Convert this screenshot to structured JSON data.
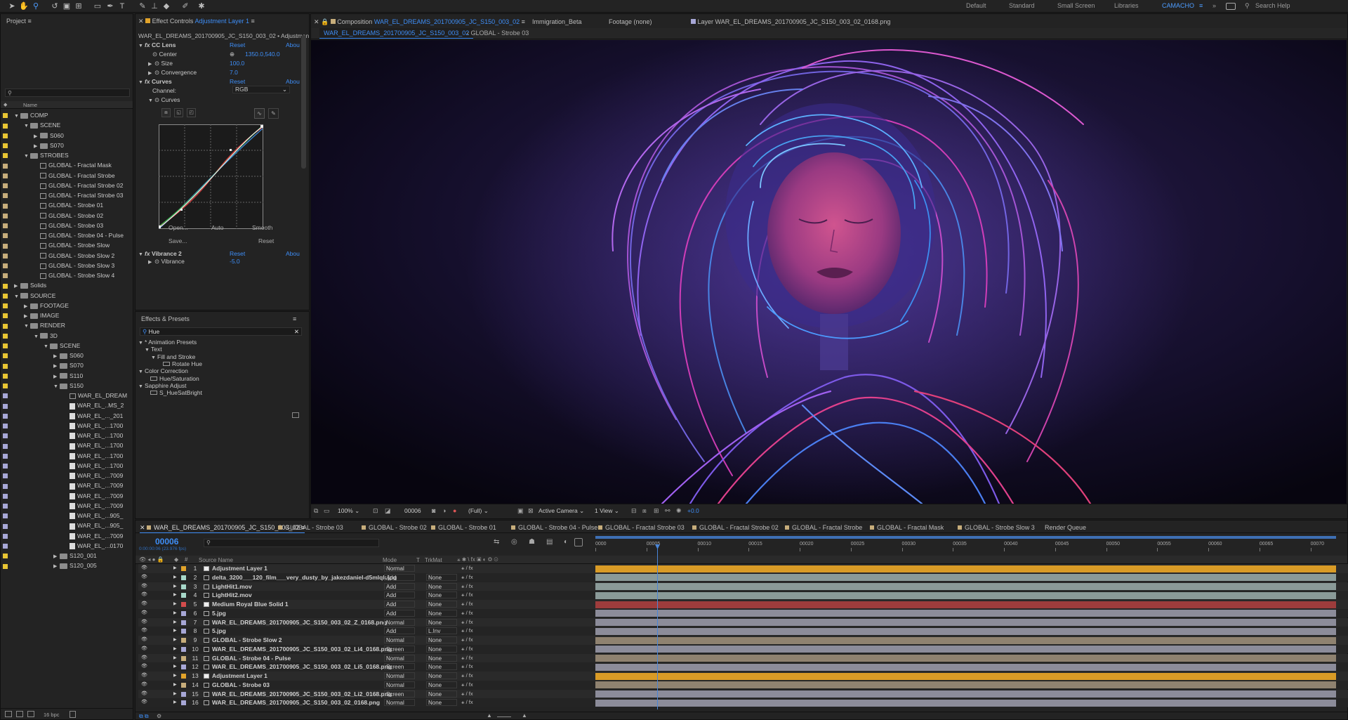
{
  "workspaces": {
    "items": [
      "Default",
      "Standard",
      "Small Screen",
      "Libraries",
      "CAMACHO"
    ],
    "search_placeholder": "Search Help"
  },
  "project": {
    "title": "Project",
    "col_name": "Name",
    "tree": [
      {
        "label": "COMP",
        "level": 0,
        "type": "folder",
        "open": true,
        "color": "#e8c533"
      },
      {
        "label": "SCENE",
        "level": 1,
        "type": "folder",
        "open": true,
        "color": "#e8c533"
      },
      {
        "label": "S060",
        "level": 2,
        "type": "folder",
        "open": false,
        "color": "#e8c533"
      },
      {
        "label": "S070",
        "level": 2,
        "type": "folder",
        "open": false,
        "color": "#e8c533"
      },
      {
        "label": "STROBES",
        "level": 1,
        "type": "folder",
        "open": true,
        "color": "#e8c533"
      },
      {
        "label": "GLOBAL - Fractal Mask",
        "level": 2,
        "type": "comp",
        "color": "#c7ad7b"
      },
      {
        "label": "GLOBAL - Fractal Strobe",
        "level": 2,
        "type": "comp",
        "color": "#c7ad7b"
      },
      {
        "label": "GLOBAL - Fractal Strobe 02",
        "level": 2,
        "type": "comp",
        "color": "#c7ad7b"
      },
      {
        "label": "GLOBAL - Fractal Strobe 03",
        "level": 2,
        "type": "comp",
        "color": "#c7ad7b"
      },
      {
        "label": "GLOBAL - Strobe 01",
        "level": 2,
        "type": "comp",
        "color": "#c7ad7b"
      },
      {
        "label": "GLOBAL - Strobe 02",
        "level": 2,
        "type": "comp",
        "color": "#c7ad7b"
      },
      {
        "label": "GLOBAL - Strobe 03",
        "level": 2,
        "type": "comp",
        "color": "#c7ad7b"
      },
      {
        "label": "GLOBAL - Strobe 04 - Pulse",
        "level": 2,
        "type": "comp",
        "color": "#c7ad7b"
      },
      {
        "label": "GLOBAL - Strobe Slow",
        "level": 2,
        "type": "comp",
        "color": "#c7ad7b"
      },
      {
        "label": "GLOBAL - Strobe Slow 2",
        "level": 2,
        "type": "comp",
        "color": "#c7ad7b"
      },
      {
        "label": "GLOBAL - Strobe Slow 3",
        "level": 2,
        "type": "comp",
        "color": "#c7ad7b"
      },
      {
        "label": "GLOBAL - Strobe Slow 4",
        "level": 2,
        "type": "comp",
        "color": "#c7ad7b"
      },
      {
        "label": "Solids",
        "level": 0,
        "type": "folder",
        "open": false,
        "color": "#e8c533"
      },
      {
        "label": "SOURCE",
        "level": 0,
        "type": "folder",
        "open": true,
        "color": "#e8c533"
      },
      {
        "label": "FOOTAGE",
        "level": 1,
        "type": "folder",
        "open": false,
        "color": "#e8c533"
      },
      {
        "label": "IMAGE",
        "level": 1,
        "type": "folder",
        "open": false,
        "color": "#e8c533"
      },
      {
        "label": "RENDER",
        "level": 1,
        "type": "folder",
        "open": true,
        "color": "#e8c533"
      },
      {
        "label": "3D",
        "level": 2,
        "type": "folder",
        "open": true,
        "color": "#e8c533"
      },
      {
        "label": "SCENE",
        "level": 3,
        "type": "folder",
        "open": true,
        "color": "#e8c533"
      },
      {
        "label": "S060",
        "level": 4,
        "type": "folder",
        "open": false,
        "color": "#e8c533"
      },
      {
        "label": "S070",
        "level": 4,
        "type": "folder",
        "open": false,
        "color": "#e8c533"
      },
      {
        "label": "S110",
        "level": 4,
        "type": "folder",
        "open": false,
        "color": "#e8c533"
      },
      {
        "label": "S150",
        "level": 4,
        "type": "folder",
        "open": true,
        "color": "#e8c533"
      },
      {
        "label": "WAR_EL_DREAM",
        "level": 5,
        "type": "comp",
        "color": "#a7a7d6"
      },
      {
        "label": "WAR_EL_..MS_2",
        "level": 5,
        "type": "file",
        "color": "#a7a7d6"
      },
      {
        "label": "WAR_EL_..._201",
        "level": 5,
        "type": "file",
        "color": "#a7a7d6"
      },
      {
        "label": "WAR_EL_...1700",
        "level": 5,
        "type": "file",
        "color": "#a7a7d6"
      },
      {
        "label": "WAR_EL_...1700",
        "level": 5,
        "type": "file",
        "color": "#a7a7d6"
      },
      {
        "label": "WAR_EL_...1700",
        "level": 5,
        "type": "file",
        "color": "#a7a7d6"
      },
      {
        "label": "WAR_EL_...1700",
        "level": 5,
        "type": "file",
        "color": "#a7a7d6"
      },
      {
        "label": "WAR_EL_...1700",
        "level": 5,
        "type": "file",
        "color": "#a7a7d6"
      },
      {
        "label": "WAR_EL_...7009",
        "level": 5,
        "type": "file",
        "color": "#a7a7d6"
      },
      {
        "label": "WAR_EL_...7009",
        "level": 5,
        "type": "file",
        "color": "#a7a7d6"
      },
      {
        "label": "WAR_EL_...7009",
        "level": 5,
        "type": "file",
        "color": "#a7a7d6"
      },
      {
        "label": "WAR_EL_...7009",
        "level": 5,
        "type": "file",
        "color": "#a7a7d6"
      },
      {
        "label": "WAR_EL_...905_",
        "level": 5,
        "type": "file",
        "color": "#a7a7d6"
      },
      {
        "label": "WAR_EL_...905_",
        "level": 5,
        "type": "file",
        "color": "#a7a7d6"
      },
      {
        "label": "WAR_EL_...7009",
        "level": 5,
        "type": "file",
        "color": "#a7a7d6"
      },
      {
        "label": "WAR_EL_...0170",
        "level": 5,
        "type": "file",
        "color": "#a7a7d6"
      },
      {
        "label": "S120_001",
        "level": 4,
        "type": "folder",
        "open": false,
        "color": "#e8c533"
      },
      {
        "label": "S120_005",
        "level": 4,
        "type": "folder",
        "open": false,
        "color": "#e8c533"
      }
    ],
    "bpc": "16 bpc"
  },
  "effect_controls": {
    "tab_prefix": "Effect Controls",
    "tab_layer": "Adjustment Layer 1",
    "breadcrumb": "WAR_EL_DREAMS_201700905_JC_S150_003_02 • Adjustment La",
    "cclens": {
      "name": "CC Lens",
      "reset": "Reset",
      "about": "Abou",
      "center_label": "Center",
      "center_value": "1350.0,540.0",
      "size_label": "Size",
      "size_value": "100.0",
      "conv_label": "Convergence",
      "conv_value": "7.0"
    },
    "curves": {
      "name": "Curves",
      "reset": "Reset",
      "about": "Abou",
      "channel_label": "Channel:",
      "channel_value": "RGB",
      "sub_label": "Curves",
      "open": "Open...",
      "auto": "Auto",
      "smooth": "Smooth",
      "save": "Save...",
      "reset2": "Reset"
    },
    "vibrance": {
      "name": "Vibrance 2",
      "reset": "Reset",
      "about": "Abou",
      "label": "Vibrance",
      "value": "-5.0"
    }
  },
  "effects_presets": {
    "title": "Effects & Presets",
    "search_value": "Hue",
    "items": [
      {
        "label": "* Animation Presets",
        "level": 0,
        "type": "group"
      },
      {
        "label": "Text",
        "level": 1,
        "type": "group"
      },
      {
        "label": "Fill and Stroke",
        "level": 2,
        "type": "group"
      },
      {
        "label": "Rotate Hue",
        "level": 3,
        "type": "item"
      },
      {
        "label": "Color Correction",
        "level": 0,
        "type": "group"
      },
      {
        "label": "Hue/Saturation",
        "level": 1,
        "type": "effect"
      },
      {
        "label": "Sapphire Adjust",
        "level": 0,
        "type": "group"
      },
      {
        "label": "S_HueSatBright",
        "level": 1,
        "type": "effect"
      }
    ]
  },
  "viewer_tabs": {
    "composition_prefix": "Composition",
    "composition_name": "WAR_EL_DREAMS_201700905_JC_S150_003_02",
    "other": [
      "Immigration_Beta",
      "Footage (none)"
    ],
    "layer_tab": "Layer WAR_EL_DREAMS_201700905_JC_S150_003_02_0168.png",
    "subtabs": [
      "WAR_EL_DREAMS_201700905_JC_S150_003_02",
      "GLOBAL - Strobe 03"
    ]
  },
  "viewer_footer": {
    "zoom": "100%",
    "frame": "00006",
    "resolution": "(Full)",
    "camera": "Active Camera",
    "views": "1 View",
    "exposure": "+0.0"
  },
  "timeline": {
    "tabs": [
      "WAR_EL_DREAMS_201700905_JC_S150_003_02",
      "GLOBAL - Strobe 03",
      "GLOBAL - Strobe 02",
      "GLOBAL - Strobe 01",
      "GLOBAL - Strobe 04 - Pulse",
      "GLOBAL - Fractal Strobe 03",
      "GLOBAL - Fractal Strobe 02",
      "GLOBAL - Fractal Strobe",
      "GLOBAL - Fractal Mask",
      "GLOBAL - Strobe Slow 3",
      "Render Queue"
    ],
    "timecode": "00006",
    "timecode_sub": "0:00:00:06 (23.976 fps)",
    "col_source": "Source Name",
    "col_mode": "Mode",
    "col_t": "T",
    "col_trkmat": "TrkMat",
    "ruler": [
      "0000",
      "00005",
      "00010",
      "00015",
      "00020",
      "00025",
      "00030",
      "00035",
      "00040",
      "00045",
      "00050",
      "00055",
      "00060",
      "00065",
      "00070"
    ],
    "layers": [
      {
        "num": "1",
        "name": "Adjustment Layer 1",
        "mode": "Normal",
        "trk": "",
        "color": "#e1a32a",
        "bar": "#d99b26",
        "icon": "solid"
      },
      {
        "num": "2",
        "name": "delta_3200___120_film___very_dusty_by_jakezdaniel-d5mlqk.jpg",
        "mode": "Add",
        "trk": "None",
        "color": "#a7d7c9",
        "bar": "#8a9a98",
        "icon": "file"
      },
      {
        "num": "3",
        "name": "LightHit1.mov",
        "mode": "Add",
        "trk": "None",
        "color": "#a7d7c9",
        "bar": "#8a9a98",
        "icon": "file"
      },
      {
        "num": "4",
        "name": "LightHit2.mov",
        "mode": "Add",
        "trk": "None",
        "color": "#a7d7c9",
        "bar": "#8a9a98",
        "icon": "file"
      },
      {
        "num": "5",
        "name": "Medium Royal Blue Solid 1",
        "mode": "Add",
        "trk": "None",
        "color": "#d34c4c",
        "bar": "#9e3c3c",
        "icon": "solid"
      },
      {
        "num": "6",
        "name": "5.jpg",
        "mode": "Add",
        "trk": "None",
        "color": "#a7a7d6",
        "bar": "#8c8c9a",
        "icon": "file"
      },
      {
        "num": "7",
        "name": "WAR_EL_DREAMS_201700905_JC_S150_003_02_Z_0168.png",
        "mode": "Normal",
        "trk": "None",
        "color": "#a7a7d6",
        "bar": "#8c8c9a",
        "icon": "file"
      },
      {
        "num": "8",
        "name": "5.jpg",
        "mode": "Add",
        "trk": "L.Inv",
        "color": "#a7a7d6",
        "bar": "#8c8c9a",
        "icon": "file"
      },
      {
        "num": "9",
        "name": "GLOBAL - Strobe Slow 2",
        "mode": "Normal",
        "trk": "None",
        "color": "#c7ad7b",
        "bar": "#8f8270",
        "icon": "comp"
      },
      {
        "num": "10",
        "name": "WAR_EL_DREAMS_201700905_JC_S150_003_02_Li4_0168.png",
        "mode": "Screen",
        "trk": "None",
        "color": "#a7a7d6",
        "bar": "#8c8c9a",
        "icon": "file"
      },
      {
        "num": "11",
        "name": "GLOBAL - Strobe 04 - Pulse",
        "mode": "Normal",
        "trk": "None",
        "color": "#c7ad7b",
        "bar": "#8f8270",
        "icon": "comp"
      },
      {
        "num": "12",
        "name": "WAR_EL_DREAMS_201700905_JC_S150_003_02_Li5_0168.png",
        "mode": "Screen",
        "trk": "None",
        "color": "#a7a7d6",
        "bar": "#8c8c9a",
        "icon": "file"
      },
      {
        "num": "13",
        "name": "Adjustment Layer 1",
        "mode": "Normal",
        "trk": "None",
        "color": "#e1a32a",
        "bar": "#d99b26",
        "icon": "solid"
      },
      {
        "num": "14",
        "name": "GLOBAL - Strobe 03",
        "mode": "Normal",
        "trk": "None",
        "color": "#c7ad7b",
        "bar": "#8f8270",
        "icon": "comp"
      },
      {
        "num": "15",
        "name": "WAR_EL_DREAMS_201700905_JC_S150_003_02_Li2_0168.png",
        "mode": "Screen",
        "trk": "None",
        "color": "#a7a7d6",
        "bar": "#8c8c9a",
        "icon": "file"
      },
      {
        "num": "16",
        "name": "WAR_EL_DREAMS_201700905_JC_S150_003_02_0168.png",
        "mode": "Normal",
        "trk": "None",
        "color": "#a7a7d6",
        "bar": "#8c8c9a",
        "icon": "file"
      }
    ]
  }
}
